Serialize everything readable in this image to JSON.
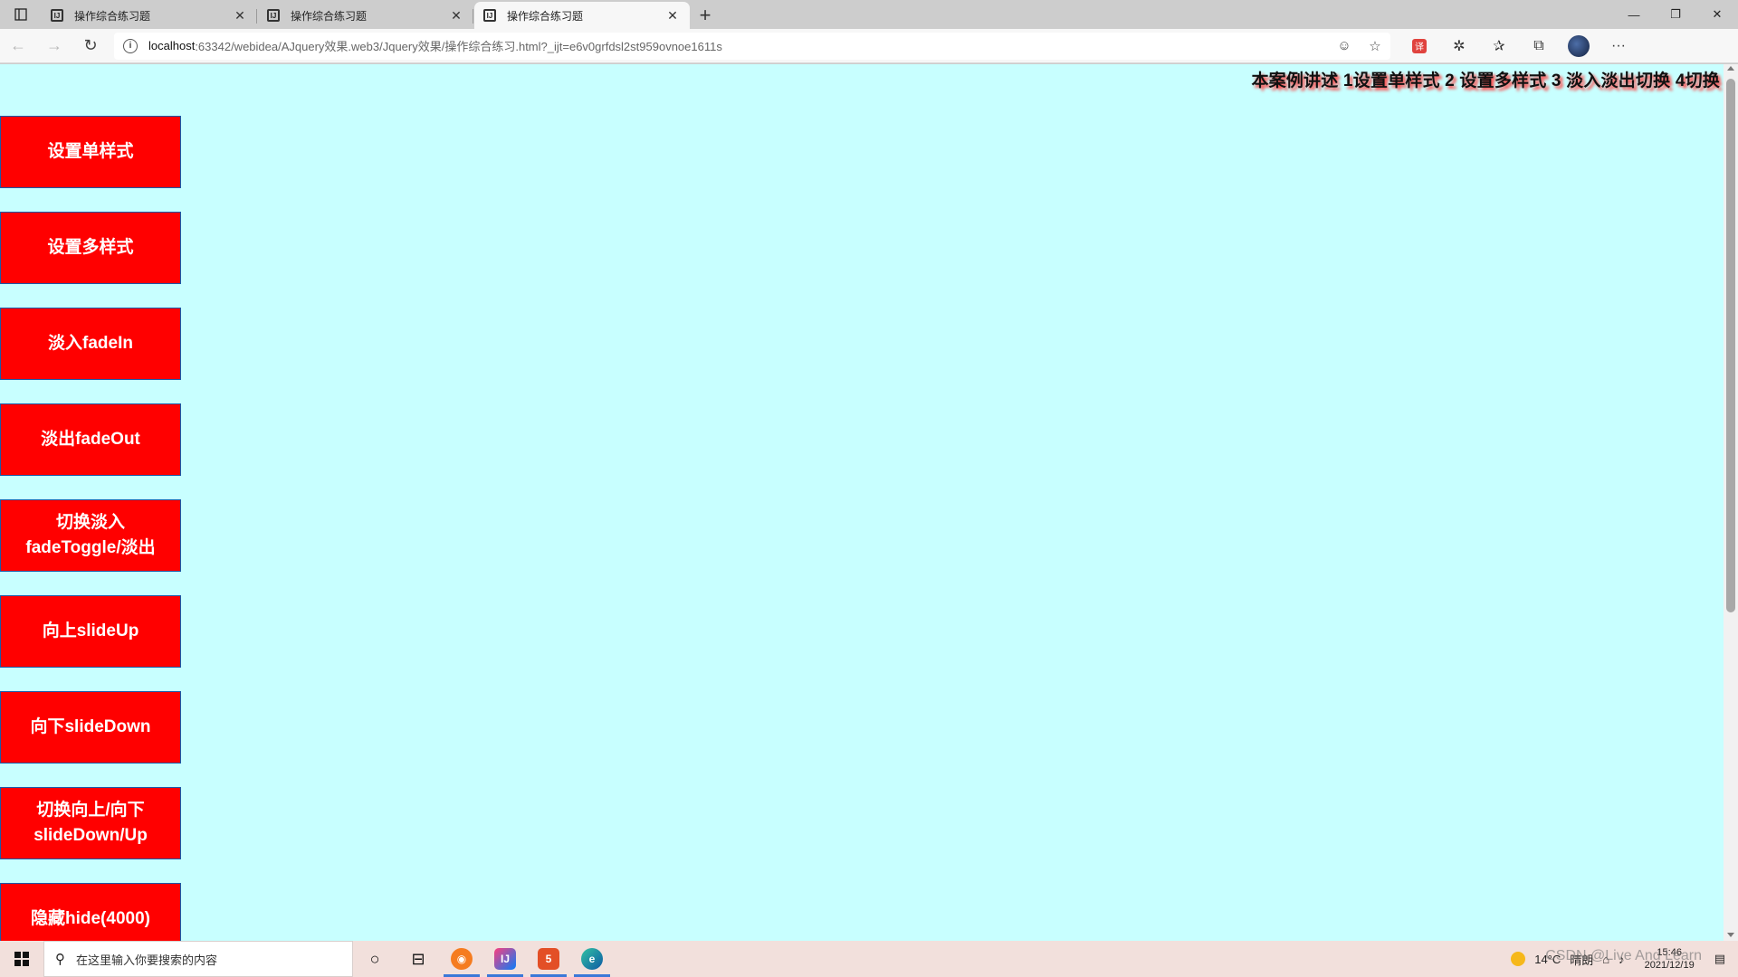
{
  "browser": {
    "tabs": [
      {
        "title": "操作综合练习题",
        "active": false
      },
      {
        "title": "操作综合练习题",
        "active": false
      },
      {
        "title": "操作综合练习题",
        "active": true
      }
    ],
    "url_host": "localhost",
    "url_path": ":63342/webidea/AJquery效果.web3/Jquery效果/操作综合练习.html?_ijt=e6v0grfdsl2st959ovnoe1611s"
  },
  "page": {
    "marquee_text": "本案例讲述 1设置单样式 2 设置多样式 3 淡入淡出切换 4切换",
    "buttons": [
      "设置单样式",
      "设置多样式",
      "淡入fadeIn",
      "淡出fadeOut",
      "切换淡入\nfadeToggle/淡出",
      "向上slideUp",
      "向下slideDown",
      "切换向上/向下\nslideDown/Up",
      "隐藏hide(4000)"
    ],
    "colors": {
      "background": "#c8ffff",
      "button_bg": "#ff0000",
      "button_text": "#ffffff"
    }
  },
  "taskbar": {
    "search_placeholder": "在这里输入你要搜索的内容",
    "weather_temp": "14°C",
    "weather_desc": "晴朗",
    "time": "15:46",
    "date": "2021/12/19",
    "watermark": "CSDN @Live And Learn"
  }
}
